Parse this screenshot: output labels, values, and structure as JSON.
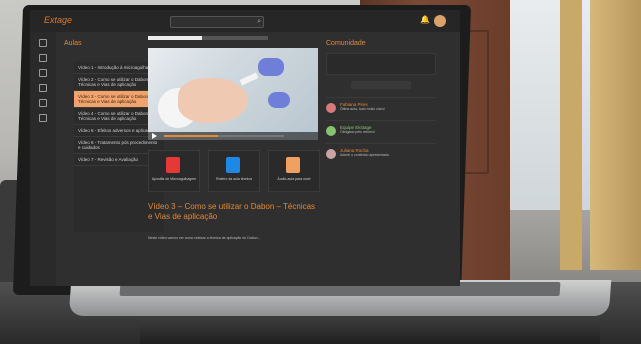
{
  "app": {
    "brand": "Extage"
  },
  "course": {
    "header": "Aulas",
    "items": [
      {
        "label": "Vídeo 1 - Introdução à microagulhagem"
      },
      {
        "label": "Vídeo 2 - Como se utilizar o Dabon - Técnicas e Vias de aplicação"
      },
      {
        "label": "Vídeo 3 - Como se utilizar o Dabon - Técnicas e Vias de aplicação",
        "active": true
      },
      {
        "label": "Vídeo 4 - Como se utilizar o Dabon - Técnicas e Vias de aplicação"
      },
      {
        "label": "Vídeo 5 - Efeitos adversos e aplicação"
      },
      {
        "label": "Vídeo 6 - Tratamento pós procedimento e cuidados"
      },
      {
        "label": "Vídeo 7 - Revisão e Avaliação"
      }
    ]
  },
  "video": {
    "progress": 0.45
  },
  "materials": [
    {
      "label": "Apostila de Microagulhagem",
      "icon": "pdf-icon",
      "color": "#e53935"
    },
    {
      "label": "Roteiro da aula técnica",
      "icon": "doc-icon",
      "color": "#1e88e5"
    },
    {
      "label": "Áudio-aula para ouvir",
      "icon": "audio-icon",
      "color": "#f0a060"
    }
  ],
  "lesson": {
    "title": "Vídeo 3 – Como se utilizar o Dabon – Técnicas e Vias de aplicação",
    "text": "Neste vídeo vamos ver como realizar a técnica de aplicação do Dabon..."
  },
  "comments": {
    "title": "Comunidade",
    "entries": [
      {
        "name": "Fabiana Pires",
        "text": "Ótima aula, tudo muito claro!"
      },
      {
        "name": "Equipe Ekstage",
        "text": "Obrigado pelo retorno!",
        "green": true
      },
      {
        "name": "Juliana Rocha",
        "text": "Adorei o conteúdo apresentado."
      }
    ]
  },
  "colors": {
    "accent": "#e08a3b"
  }
}
